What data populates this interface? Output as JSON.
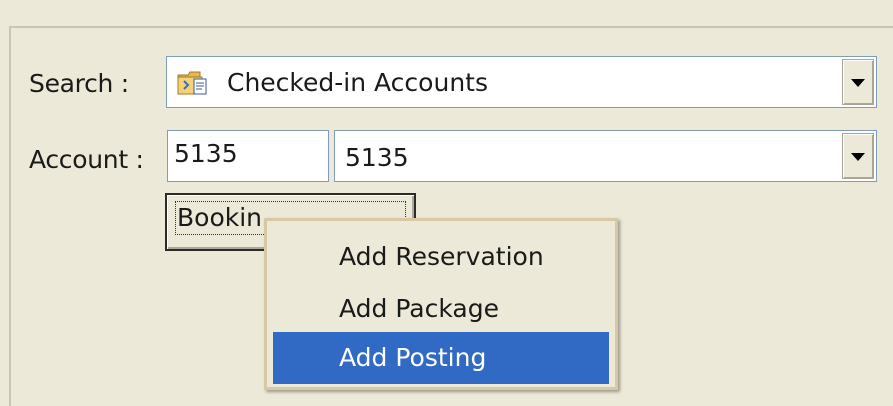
{
  "search": {
    "label": "Search :",
    "selected": "Checked-in Accounts",
    "icon": "folder-search-icon"
  },
  "account": {
    "label": "Account :",
    "number": "5135",
    "selected": "5135"
  },
  "booking_button": {
    "label": "Bookin"
  },
  "context_menu": {
    "items": [
      {
        "label": "Add Reservation"
      },
      {
        "label": "Add Package"
      },
      {
        "label": "Add Posting"
      }
    ],
    "selected_index": 2
  },
  "colors": {
    "window_bg": "#ece9d8",
    "field_border": "#7f9db9",
    "selection": "#316ac5"
  }
}
